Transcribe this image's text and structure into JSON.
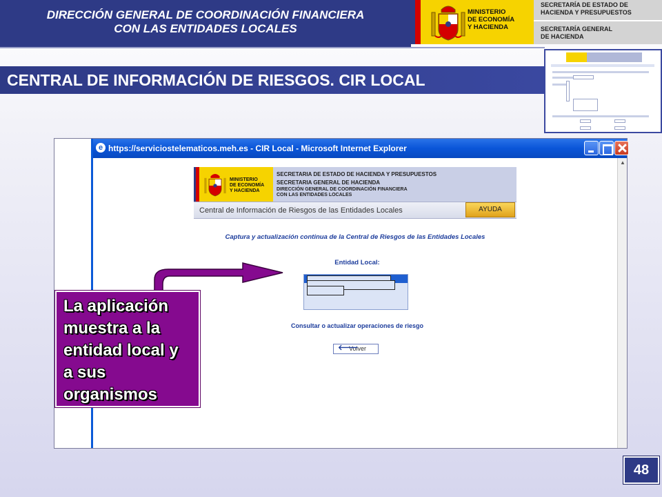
{
  "header": {
    "left_line1": "DIRECCIÓN GENERAL DE COORDINACIÓN FINANCIERA",
    "left_line2": "CON LAS ENTIDADES LOCALES",
    "ministry_line1": "MINISTERIO",
    "ministry_line2": "DE ECONOMÍA",
    "ministry_line3": "Y HACIENDA",
    "right_top_line1": "SECRETARÍA DE ESTADO DE",
    "right_top_line2": "HACIENDA Y PRESUPUESTOS",
    "right_bottom_line1": "SECRETARÍA GENERAL",
    "right_bottom_line2": "DE HACIENDA",
    "coat_of_arms_icon": "spain-coat-of-arms-icon"
  },
  "title": "CENTRAL DE INFORMACIÓN DE RIESGOS. CIR LOCAL",
  "browser": {
    "window_title": "https://serviciostelematicos.meh.es - CIR Local - Microsoft Internet Explorer",
    "app_icon": "ie-icon",
    "site": {
      "ministry_line1": "MINISTERIO",
      "ministry_line2": "DE ECONOMÍA",
      "ministry_line3": "Y HACIENDA",
      "banner_line1": "SECRETARIA DE ESTADO DE HACIENDA Y PRESUPUESTOS",
      "banner_line2": "SECRETARIA GENERAL DE HACIENDA",
      "banner_line3": "DIRECCIÓN GENERAL DE COORDINACIÓN FINANCIERA",
      "banner_line4": "CON LAS ENTIDADES LOCALES",
      "bar_title": "Central de Información de Riesgos de las Entidades Locales",
      "help_button": "AYUDA",
      "caption": "Captura y actualización continua de la Central de Riesgos de las Entidades Locales",
      "entity_label": "Entidad Local:",
      "consult_link": "Consultar o actualizar operaciones de riesgo",
      "back_button": "Volver"
    }
  },
  "callout": {
    "line1": "La aplicación",
    "line2": "muestra a la",
    "line3": "entidad local y",
    "line4": "a sus",
    "line5": "organismos"
  },
  "page_number": "48",
  "colors": {
    "navy": "#2e3a86",
    "yellow": "#f6d300",
    "purple": "#850a8f",
    "ie_blue": "#0a55d8"
  }
}
